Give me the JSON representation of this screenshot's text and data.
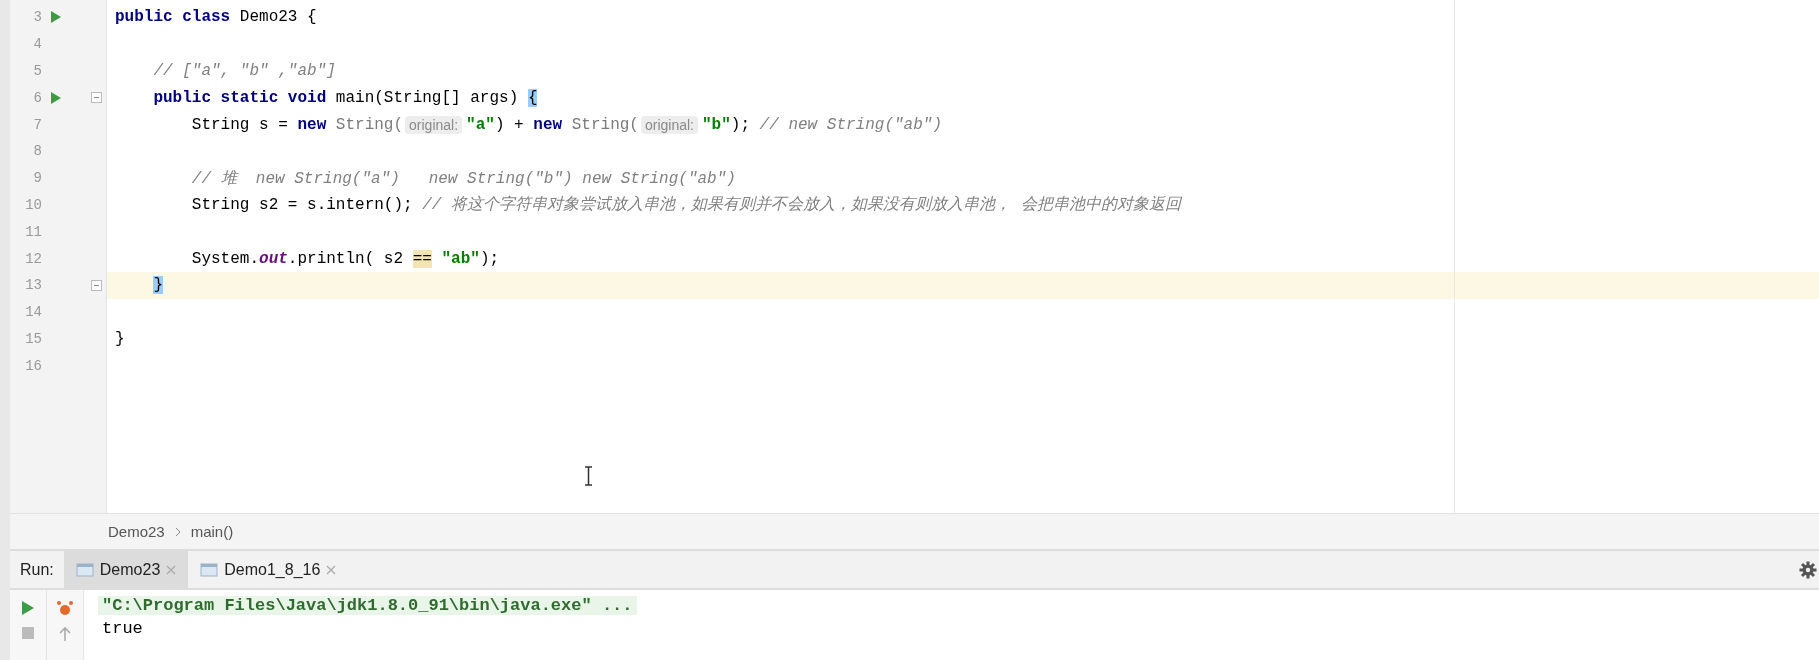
{
  "editor": {
    "lines": [
      {
        "number": "3",
        "run_icon": true,
        "fold": false,
        "current": false,
        "segments": [
          {
            "kind": "keyword",
            "text": "public class "
          },
          {
            "kind": "text",
            "text": "Demo23 {"
          }
        ]
      },
      {
        "number": "4",
        "run_icon": false,
        "fold": false,
        "current": false
      },
      {
        "number": "5",
        "run_icon": false,
        "fold": false,
        "current": false,
        "segments": [
          {
            "kind": "comment",
            "text": "    // [\"a\", \"b\" ,\"ab\"]"
          }
        ]
      },
      {
        "number": "6",
        "run_icon": true,
        "fold": true,
        "current": false,
        "segments": [
          {
            "kind": "keyword",
            "text": "    public static void "
          },
          {
            "kind": "text",
            "text": "main(String[] args) "
          },
          {
            "kind": "brace_match",
            "text": "{"
          }
        ]
      },
      {
        "number": "7",
        "run_icon": false,
        "fold": false,
        "current": false,
        "segments": [
          {
            "kind": "text",
            "text": "        String s = "
          },
          {
            "kind": "keyword",
            "text": "new "
          },
          {
            "kind": "type",
            "text": "String("
          },
          {
            "kind": "hint",
            "text": "original:"
          },
          {
            "kind": "string",
            "text": "\"a\""
          },
          {
            "kind": "text",
            "text": ") + "
          },
          {
            "kind": "keyword",
            "text": "new "
          },
          {
            "kind": "type",
            "text": "String("
          },
          {
            "kind": "hint",
            "text": "original:"
          },
          {
            "kind": "string",
            "text": "\"b\""
          },
          {
            "kind": "text",
            "text": "); "
          },
          {
            "kind": "comment",
            "text": "// new String(\"ab\")"
          }
        ]
      },
      {
        "number": "8",
        "run_icon": false,
        "fold": false,
        "current": false
      },
      {
        "number": "9",
        "run_icon": false,
        "fold": false,
        "current": false,
        "segments": [
          {
            "kind": "comment",
            "text": "        // 堆  new String(\"a\")   new String(\"b\") new String(\"ab\")"
          }
        ]
      },
      {
        "number": "10",
        "run_icon": false,
        "fold": false,
        "current": false,
        "segments": [
          {
            "kind": "text",
            "text": "        String s2 = s.intern(); "
          },
          {
            "kind": "comment",
            "text": "// 将这个字符串对象尝试放入串池，如果有则并不会放入，如果没有则放入串池， 会把串池中的对象返回"
          }
        ]
      },
      {
        "number": "11",
        "run_icon": false,
        "fold": false,
        "current": false
      },
      {
        "number": "12",
        "run_icon": false,
        "fold": false,
        "current": false,
        "segments": [
          {
            "kind": "text",
            "text": "        System."
          },
          {
            "kind": "static_field",
            "text": "out"
          },
          {
            "kind": "text",
            "text": ".println( s2 "
          },
          {
            "kind": "usage",
            "text": "=="
          },
          {
            "kind": "string",
            "text": " \"ab\""
          },
          {
            "kind": "text",
            "text": ");"
          }
        ]
      },
      {
        "number": "13",
        "run_icon": false,
        "fold": true,
        "current": true,
        "segments": [
          {
            "kind": "brace_match",
            "text": "    }"
          }
        ]
      },
      {
        "number": "14",
        "run_icon": false,
        "fold": false,
        "current": false
      },
      {
        "number": "15",
        "run_icon": false,
        "fold": false,
        "current": false,
        "segments": [
          {
            "kind": "text",
            "text": "}"
          }
        ]
      },
      {
        "number": "16",
        "run_icon": false,
        "fold": false,
        "current": false
      }
    ]
  },
  "breadcrumb": [
    "Demo23",
    "main()"
  ],
  "run_panel": {
    "label": "Run:",
    "tabs": [
      {
        "label": "Demo23",
        "selected": true
      },
      {
        "label": "Demo1_8_16",
        "selected": false
      }
    ],
    "console": [
      {
        "kind": "command",
        "text": "\"C:\\Program Files\\Java\\jdk1.8.0_91\\bin\\java.exe\" ..."
      },
      {
        "kind": "output",
        "text": "true"
      }
    ]
  }
}
